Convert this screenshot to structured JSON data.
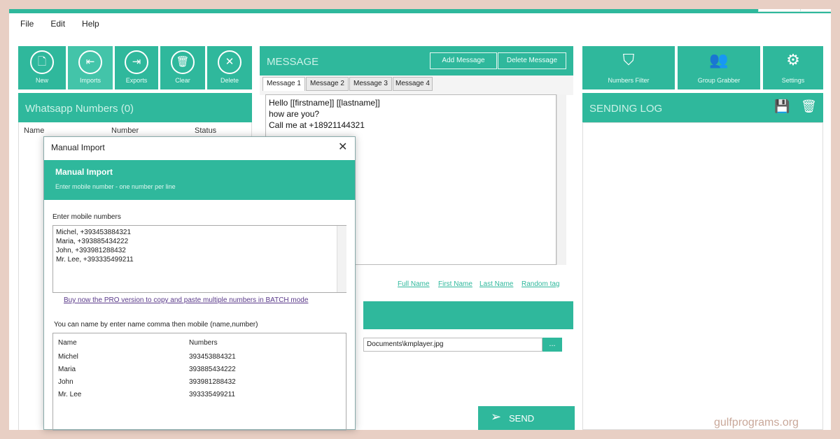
{
  "menu": [
    "File",
    "Edit",
    "Help"
  ],
  "toolbar_left": [
    {
      "label": "New",
      "icon": "new-file-icon",
      "glyph": "🗋"
    },
    {
      "label": "Imports",
      "icon": "import-icon",
      "glyph": "⇤"
    },
    {
      "label": "Exports",
      "icon": "export-icon",
      "glyph": "⇥"
    },
    {
      "label": "Clear",
      "icon": "trash-icon",
      "glyph": "🗑"
    },
    {
      "label": "Delete",
      "icon": "close-icon",
      "glyph": "✕"
    }
  ],
  "numbers_panel": {
    "title": "Whatsapp Numbers (0)",
    "columns": [
      "Name",
      "Number",
      "Status"
    ]
  },
  "message_panel": {
    "title": "MESSAGE",
    "add_button": "Add Message",
    "delete_button": "Delete Message",
    "tabs": [
      "Message 1",
      "Message 2",
      "Message 3",
      "Message 4"
    ],
    "body_lines": [
      "Hello [[firstname]] [[lastname]]",
      "how are you?",
      "Call me at +18921144321"
    ],
    "links": [
      "Full Name",
      "First Name",
      "Last Name",
      "Random tag"
    ],
    "attachment_path": "Documents\\kmplayer.jpg",
    "browse_label": "...",
    "send_label": "SEND"
  },
  "toolbar_right": [
    {
      "label": "Numbers Filter",
      "icon": "filter-icon",
      "glyph": "⛉"
    },
    {
      "label": "Group Grabber",
      "icon": "group-icon",
      "glyph": "👥"
    },
    {
      "label": "Settings",
      "icon": "gear-icon",
      "glyph": "⚙"
    }
  ],
  "log_panel": {
    "title": "SENDING LOG",
    "save_icon": "💾",
    "trash_icon": "🗑"
  },
  "dialog": {
    "window_title": "Manual Import",
    "header_title": "Manual Import",
    "header_subtitle": "Enter mobile number - one number per line",
    "input_label": "Enter mobile numbers",
    "input_lines": [
      "Michel, +393453884321",
      "Maria, +393885434222",
      "John, +393981288432",
      "Mr. Lee, +393335499211"
    ],
    "promo_link": "Buy now the PRO version to copy and paste multiple numbers in BATCH mode",
    "hint": "You can name by enter name comma then mobile (name,number)",
    "columns": [
      "Name",
      "Numbers"
    ],
    "rows": [
      [
        "Michel",
        "393453884321"
      ],
      [
        "Maria",
        "393885434222"
      ],
      [
        "John",
        "393981288432"
      ],
      [
        "Mr. Lee",
        "393335499211"
      ]
    ]
  },
  "watermark": "gulfprograms.org",
  "colors": {
    "accent": "#2fb89c",
    "background": "#e8cfc4"
  }
}
